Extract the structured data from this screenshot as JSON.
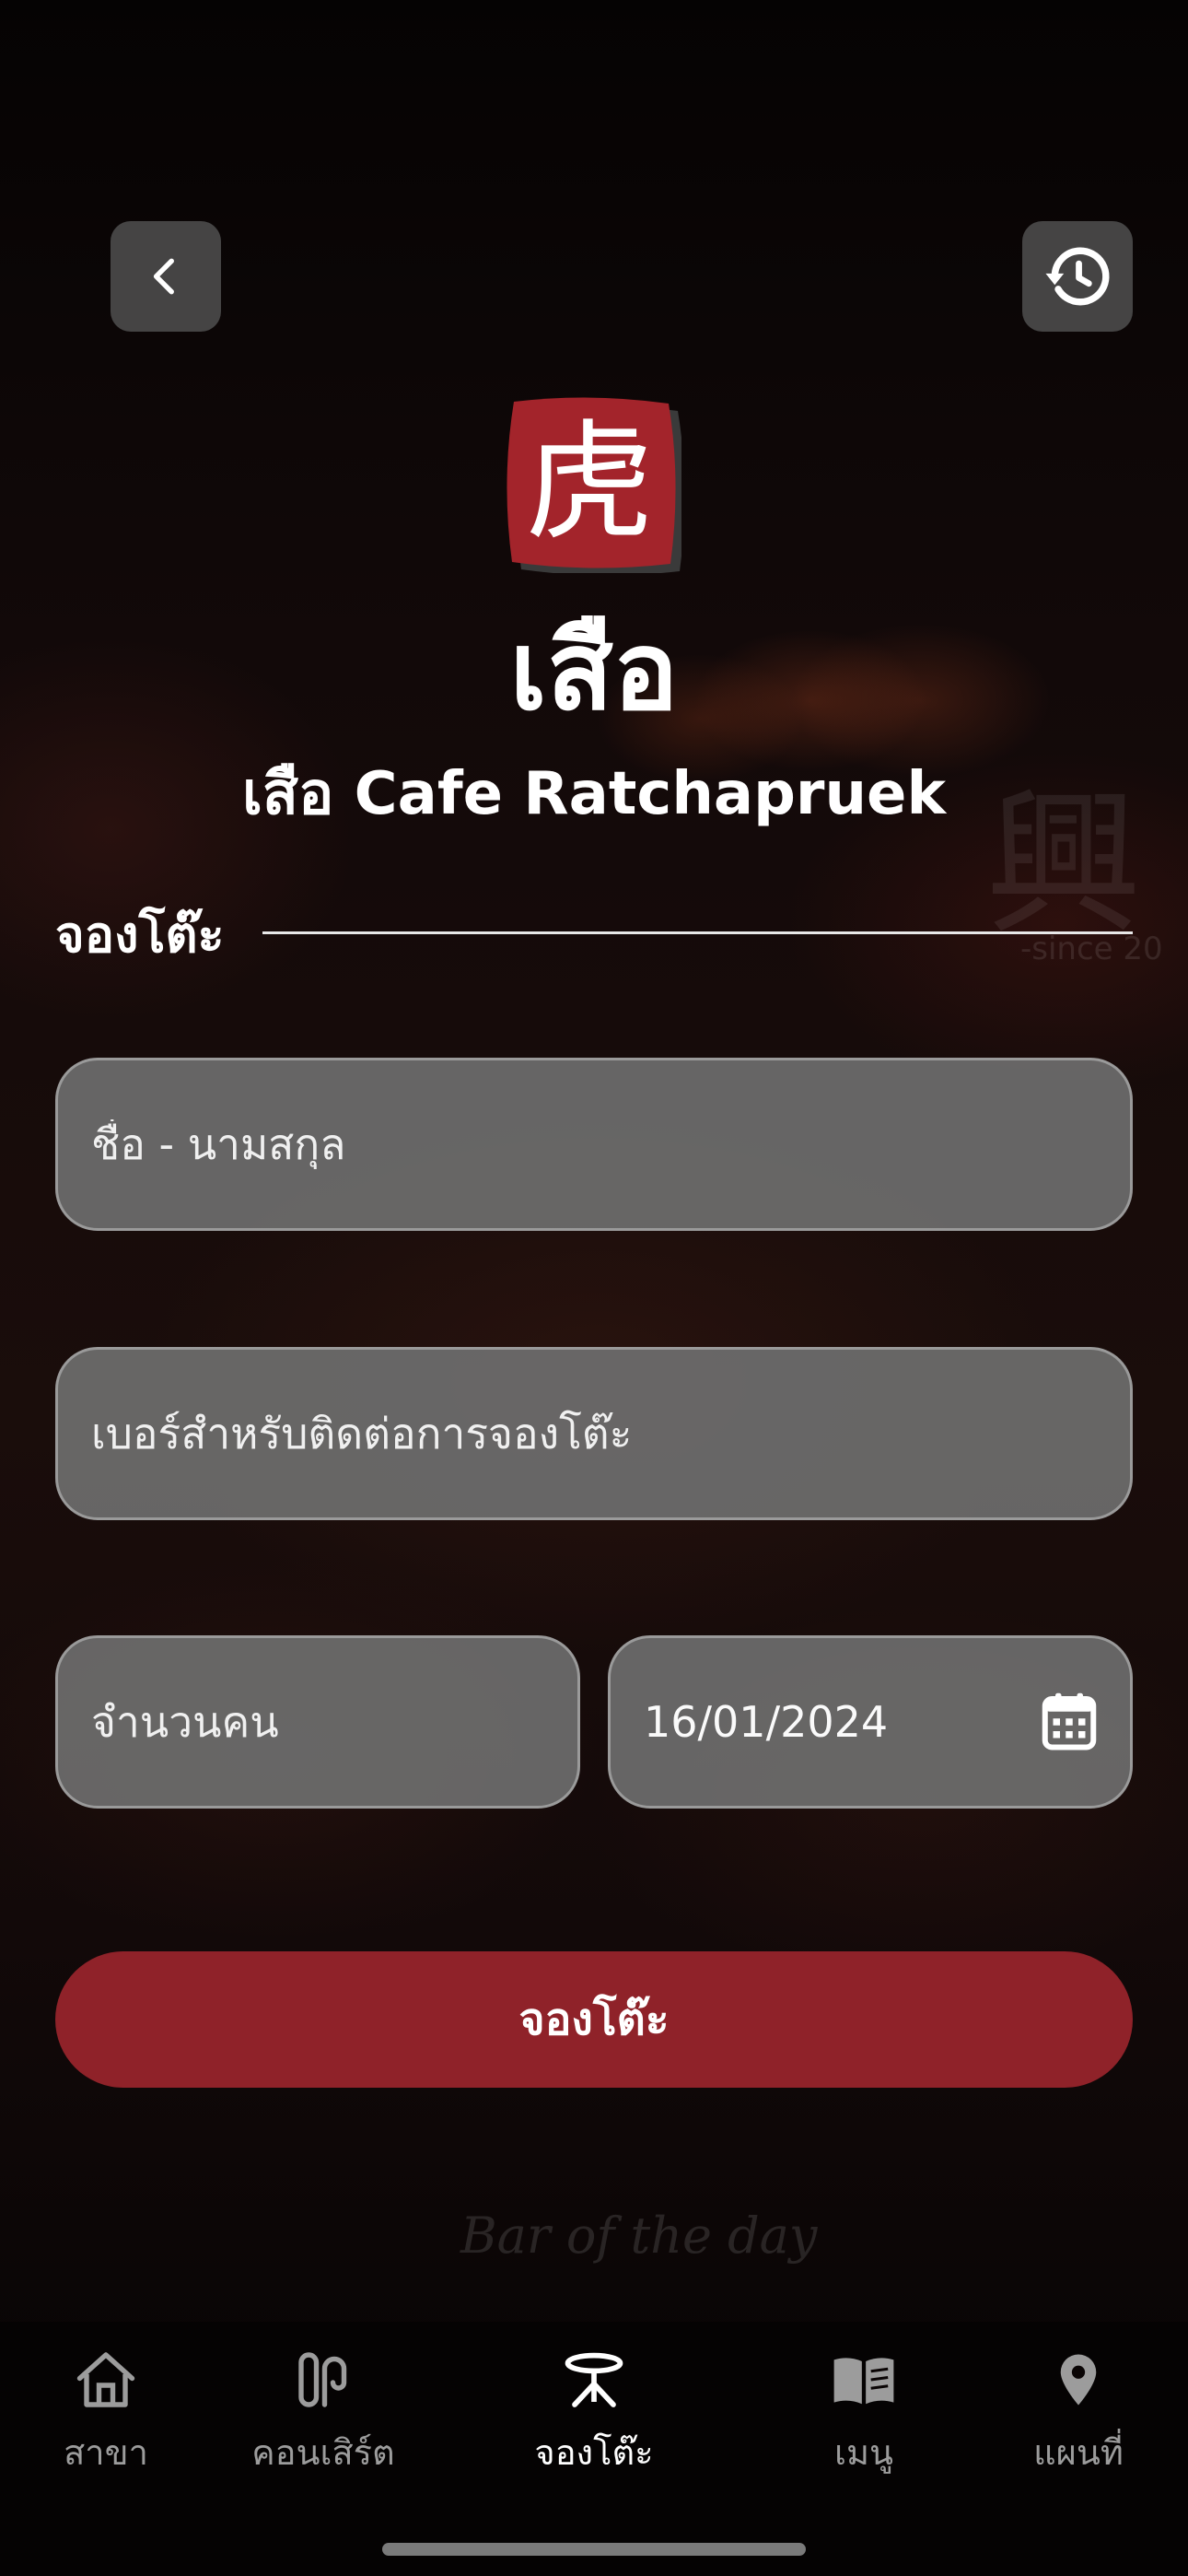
{
  "header": {
    "back_icon": "chevron-left-icon",
    "history_icon": "history-icon",
    "logo_glyph": "虎",
    "brand_word": "เสือ",
    "cafe_name": "เสือ Cafe Ratchapruek"
  },
  "background": {
    "watermark": "興",
    "since_text": "-since 20",
    "tagline": "Bar of the day"
  },
  "form": {
    "section_title": "จองโต๊ะ",
    "name_placeholder": "ชื่อ - นามสกุล",
    "phone_placeholder": "เบอร์สำหรับติดต่อการจองโต๊ะ",
    "guests_placeholder": "จำนวนคน",
    "date_value": "16/01/2024",
    "date_icon": "calendar-icon",
    "submit_label": "จองโต๊ะ"
  },
  "tabs": [
    {
      "label": "สาขา",
      "icon": "home-icon",
      "active": false
    },
    {
      "label": "คอนเสิร์ต",
      "icon": "microphone-icon",
      "active": false
    },
    {
      "label": "จองโต๊ะ",
      "icon": "table-icon",
      "active": true
    },
    {
      "label": "เมนู",
      "icon": "book-icon",
      "active": false
    },
    {
      "label": "แผนที่",
      "icon": "location-pin-icon",
      "active": false
    }
  ],
  "colors": {
    "accent": "#8f2229",
    "field_bg": "#6e6e6e",
    "tab_inactive": "#9c9c9c",
    "tab_active": "#ffffff"
  }
}
